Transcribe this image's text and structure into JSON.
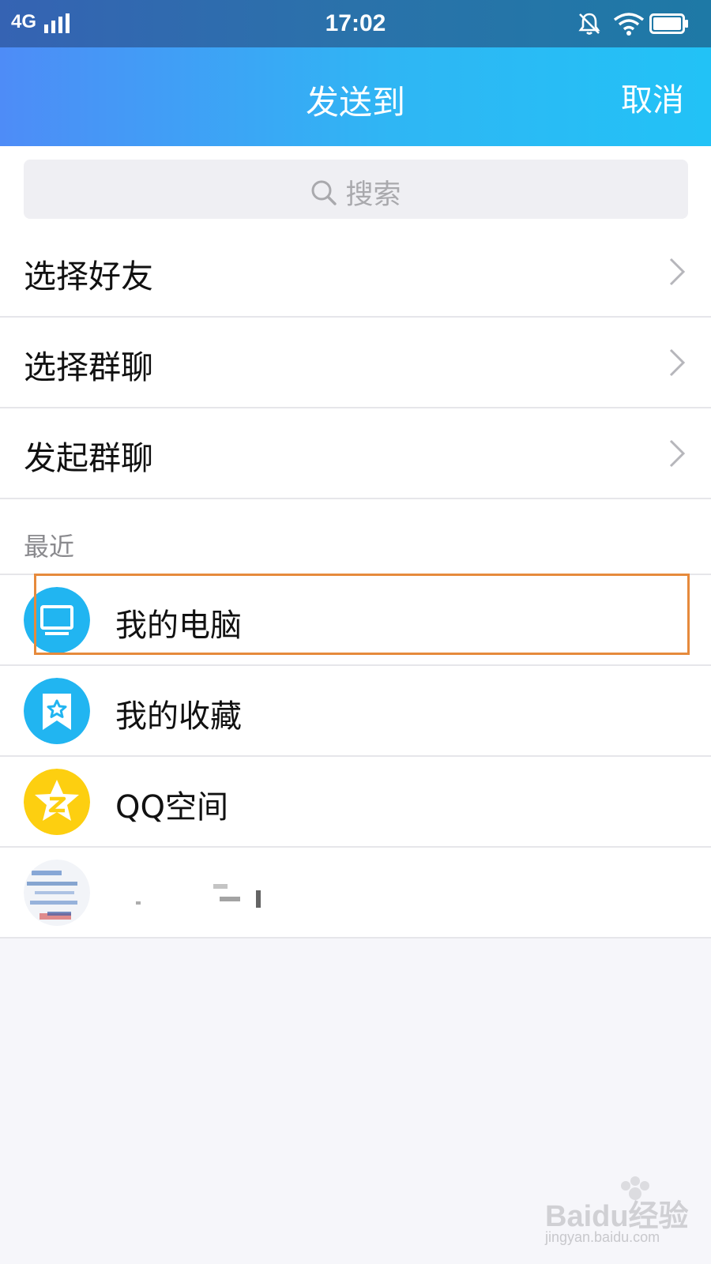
{
  "status_bar": {
    "network": "4G",
    "time": "17:02"
  },
  "nav": {
    "title": "发送到",
    "cancel_label": "取消"
  },
  "search": {
    "placeholder": "搜索"
  },
  "menu": {
    "items": [
      {
        "label": "选择好友"
      },
      {
        "label": "选择群聊"
      },
      {
        "label": "发起群聊"
      }
    ]
  },
  "recent": {
    "section_label": "最近",
    "contacts": [
      {
        "name": "我的电脑",
        "icon": "monitor-icon"
      },
      {
        "name": "我的收藏",
        "icon": "bookmark-star-icon"
      },
      {
        "name": "QQ空间",
        "icon": "qzone-star-icon"
      },
      {
        "name": "",
        "icon": "blurred-avatar"
      }
    ]
  },
  "watermark": {
    "text": "Baidu经验",
    "url": "jingyan.baidu.com"
  },
  "colors": {
    "header_start": "#4e8cf7",
    "header_end": "#22c2f6",
    "status_bar": "#2a72aa",
    "avatar_blue": "#21b5f1",
    "qzone_yellow": "#fdcf10",
    "highlight": "#e68a3c"
  }
}
